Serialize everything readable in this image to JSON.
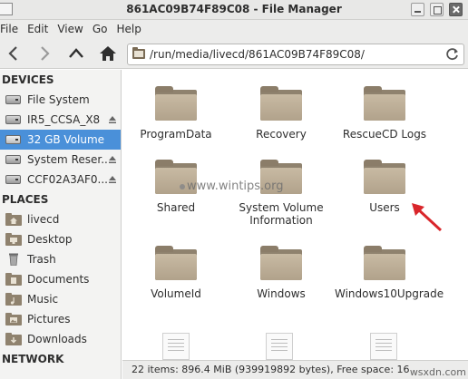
{
  "window": {
    "title": "861AC09B74F89C08 - File Manager"
  },
  "menu": [
    "File",
    "Edit",
    "View",
    "Go",
    "Help"
  ],
  "toolbar": {
    "path": "/run/media/livecd/861AC09B74F89C08/"
  },
  "sidebar": {
    "devices_header": "DEVICES",
    "devices": [
      {
        "label": "File System",
        "icon": "drive-icon",
        "eject": false
      },
      {
        "label": "IR5_CCSA_X8",
        "icon": "drive-icon",
        "eject": true
      },
      {
        "label": "32 GB Volume",
        "icon": "drive-icon",
        "eject": false,
        "active": true
      },
      {
        "label": "System Reser...",
        "icon": "drive-icon",
        "eject": true
      },
      {
        "label": "CCF02A3AF0...",
        "icon": "drive-icon",
        "eject": true
      }
    ],
    "places_header": "PLACES",
    "places": [
      {
        "label": "livecd",
        "icon": "home-folder-icon"
      },
      {
        "label": "Desktop",
        "icon": "desktop-folder-icon"
      },
      {
        "label": "Trash",
        "icon": "trash-icon"
      },
      {
        "label": "Documents",
        "icon": "documents-folder-icon"
      },
      {
        "label": "Music",
        "icon": "music-folder-icon"
      },
      {
        "label": "Pictures",
        "icon": "pictures-folder-icon"
      },
      {
        "label": "Downloads",
        "icon": "downloads-folder-icon"
      }
    ],
    "network_header": "NETWORK"
  },
  "content": {
    "folders": [
      {
        "name": "ProgramData"
      },
      {
        "name": "Recovery"
      },
      {
        "name": "RescueCD Logs"
      },
      {
        "name": "Shared"
      },
      {
        "name": "System Volume Information"
      },
      {
        "name": "Users"
      },
      {
        "name": "VolumeId"
      },
      {
        "name": "Windows"
      },
      {
        "name": "Windows10Upgrade"
      }
    ]
  },
  "status": {
    "text": "22 items: 896.4 MiB (939919892 bytes), Free space: 16"
  },
  "watermark": {
    "text": "www.wintips.org",
    "corner": "wsxdn.com"
  },
  "colors": {
    "selection": "#4a90d9",
    "annotation_arrow": "#d9262b",
    "folder": "#b6a890"
  }
}
